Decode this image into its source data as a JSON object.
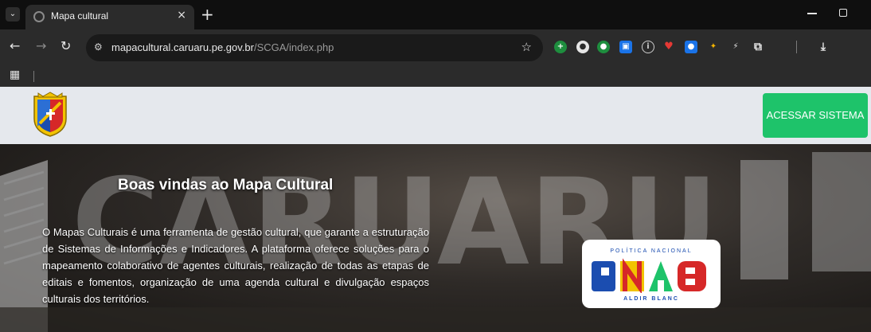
{
  "browser": {
    "tab_title": "Mapa cultural",
    "tab_close": "×",
    "new_tab": "+",
    "url_host": "mapacultural.caruaru.pe.gov.br",
    "url_path": "/SCGA/index.php",
    "icons": [
      "tab-search-icon",
      "back-icon",
      "forward-icon",
      "reload-icon",
      "site-info-icon",
      "star-icon",
      "extensions-icon",
      "download-icon",
      "apps-icon"
    ]
  },
  "header": {
    "access_button": "ACESSAR SISTEMA",
    "accent_color": "#1ec36a"
  },
  "hero": {
    "background_text": "CARUARU",
    "title": "Boas vindas ao Mapa Cultural",
    "description": "O Mapas Culturais é uma ferramenta de gestão cultural, que garante a estruturação de Sistemas de Informações e Indicadores. A plataforma oferece soluções para o mapeamento colaborativo de agentes culturais, realização de todas as etapas de editais e fomentos, organização de uma agenda cultural e divulgação espaços culturais dos territórios."
  },
  "pnab_logo": {
    "top": "POLÍTICA NACIONAL",
    "word": "PNAB",
    "bottom": "ALDIR BLANC"
  }
}
